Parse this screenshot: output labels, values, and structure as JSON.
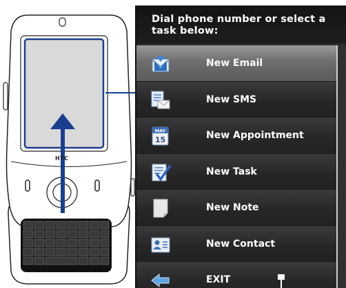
{
  "phone": {
    "brand": "HTC"
  },
  "panel": {
    "header": "Dial phone number or select a task below:",
    "calendar_month": "MAY",
    "calendar_day": "15",
    "items": [
      {
        "label": "New Email",
        "icon": "email-icon",
        "selected": true
      },
      {
        "label": "New SMS",
        "icon": "sms-icon",
        "selected": false
      },
      {
        "label": "New Appointment",
        "icon": "calendar-icon",
        "selected": false
      },
      {
        "label": "New Task",
        "icon": "task-icon",
        "selected": false
      },
      {
        "label": "New Note",
        "icon": "note-icon",
        "selected": false
      },
      {
        "label": "New Contact",
        "icon": "contact-icon",
        "selected": false
      },
      {
        "label": "EXIT",
        "icon": "exit-arrow-icon",
        "selected": false
      }
    ]
  },
  "colors": {
    "accent": "#1a3f8f",
    "screen": "#d9d9d9",
    "panel_bg": "#2a2a2a",
    "selected_row": "#7a7a7a"
  }
}
